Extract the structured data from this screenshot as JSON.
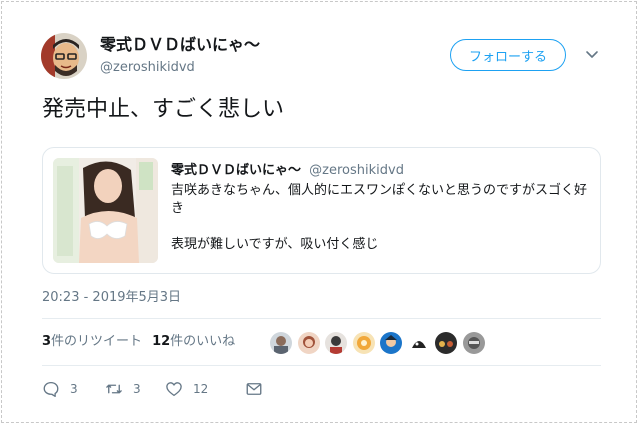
{
  "author": {
    "display_name": "零式ＤＶＤばいにゃ〜",
    "handle": "@zeroshikidvd",
    "follow_label": "フォローする"
  },
  "tweet": {
    "text": "発売中止、すごく悲しい",
    "timestamp": "20:23 - 2019年5月3日"
  },
  "quoted": {
    "display_name": "零式ＤＶＤばいにゃ〜",
    "handle": "@zeroshikidvd",
    "line1": "吉咲あきなちゃん、個人的にエスワンぽくないと思うのですがスゴく好き",
    "line2": "表現が難しいですが、吸い付く感じ"
  },
  "stats": {
    "retweet_count": "3",
    "retweet_label": "件のリツイート",
    "like_count": "12",
    "like_label": "件のいいね"
  },
  "actions": {
    "reply_count": "3",
    "retweet_count": "3",
    "like_count": "12"
  },
  "icons": {
    "reply": "reply-icon",
    "retweet": "retweet-icon",
    "like": "heart-icon",
    "message": "envelope-icon",
    "menu": "chevron-down-icon"
  },
  "colors": {
    "accent": "#1da1f2",
    "secondary_text": "#657786",
    "border": "#e1e8ed"
  }
}
